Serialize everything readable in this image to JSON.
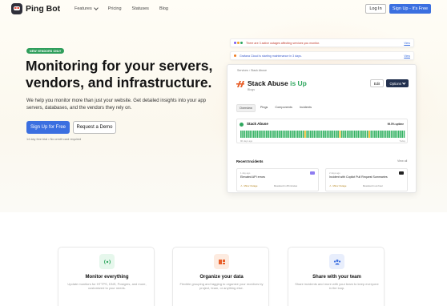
{
  "brand": {
    "name": "Ping Bot"
  },
  "nav": {
    "links": [
      "Features",
      "Pricing",
      "Statuses",
      "Blog"
    ],
    "login": "Log In",
    "signup": "Sign Up - It's Free"
  },
  "hero": {
    "badge": "NEW VENDORS ONLY",
    "headline": "Monitoring for your servers, vendors, and infrastructure.",
    "subtext": "We help you monitor more than just your website. Get detailed insights into your app servers, databases, and the vendors they rely on.",
    "primary_cta": "Sign Up for Free",
    "secondary_cta": "Request a Demo",
    "fineprint": "14 day free trial • No credit card required"
  },
  "mockup": {
    "alerts": [
      {
        "text": "There are 3 active outages affecting services you monitor.",
        "link": "View",
        "color": "#c0392b"
      },
      {
        "text": "Grafana Cloud is starting maintenance in 3 days.",
        "link": "View",
        "color": "#3b5bcc"
      }
    ],
    "breadcrumb": "Services  ›  Stack Abuse",
    "service": {
      "name": "Stack Abuse",
      "status": "is Up",
      "type": "Blogs"
    },
    "edit": "Edit",
    "options": "Options",
    "tabs": [
      "Overview",
      "Pings",
      "Components",
      "Incidents"
    ],
    "uptime": {
      "name": "Stack Abuse",
      "pct": "99.5% uptime",
      "start": "90 days ago",
      "end": "Today",
      "bars": "gggggggggggggggggggggggggggggggggggyggggggggggggggggggygggggggggggggggyggggggggggggggggggg"
    },
    "recent_incidents": {
      "title": "Recent Incidents",
      "view_all": "View all",
      "items": [
        {
          "time": "1 day ago",
          "name": "Elevated API errors",
          "badge": "Minor Outage",
          "resolved": "Resolved in 28 minutes",
          "icon_color": "#8e7cf0"
        },
        {
          "time": "2 days ago",
          "name": "Incident with Copilot Pull Request Summaries",
          "badge": "Minor Outage",
          "resolved": "Resolved in an hour",
          "icon_color": "#222"
        }
      ]
    }
  },
  "features": [
    {
      "title": "Monitor everything",
      "desc": "Update monitors for HTTPS, DNS, Postgres, and more, customized to your needs.",
      "icon": "signal-icon",
      "bg": "#e6f7ec",
      "fg": "#2fa75e"
    },
    {
      "title": "Organize your data",
      "desc": "Flexible grouping and tagging to organize your monitors by project, team, or anything else.",
      "icon": "blocks-icon",
      "bg": "#fdebe0",
      "fg": "#e8612c"
    },
    {
      "title": "Share with your team",
      "desc": "Share incidents and more with your team to keep everyone in the loop.",
      "icon": "team-icon",
      "bg": "#e8eefc",
      "fg": "#3b6fe0"
    }
  ]
}
